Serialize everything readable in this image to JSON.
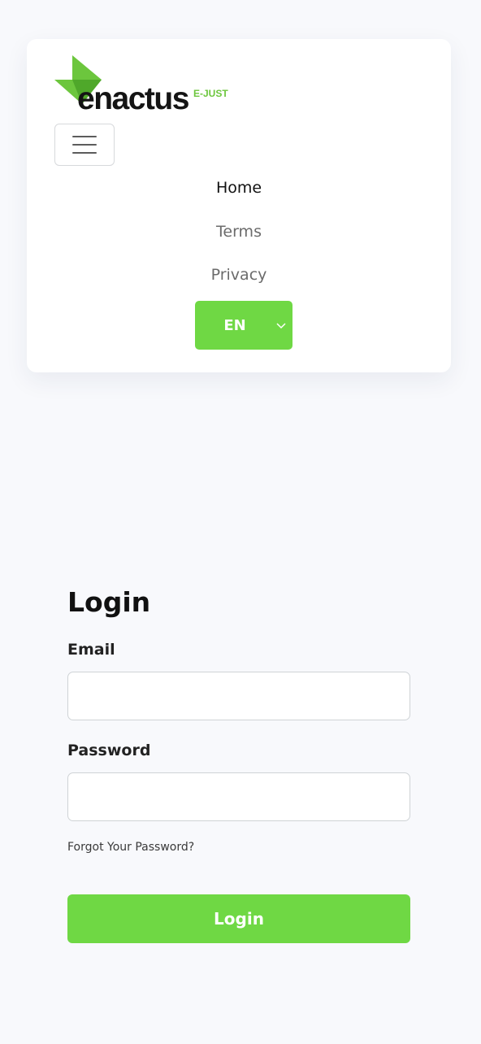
{
  "brand": {
    "logo_word": "enactus",
    "logo_sub": "E-JUST",
    "accent_color": "#6fd844",
    "logo_green": "#6cc63d"
  },
  "nav": {
    "menu_icon": "hamburger-menu-icon",
    "links": [
      {
        "label": "Home",
        "active": true
      },
      {
        "label": "Terms",
        "active": false
      },
      {
        "label": "Privacy",
        "active": false
      }
    ],
    "language": {
      "selected": "EN",
      "icon": "chevron-down-icon"
    }
  },
  "login": {
    "title": "Login",
    "email_label": "Email",
    "email_value": "",
    "password_label": "Password",
    "password_value": "",
    "forgot_label": "Forgot Your Password?",
    "submit_label": "Login"
  }
}
